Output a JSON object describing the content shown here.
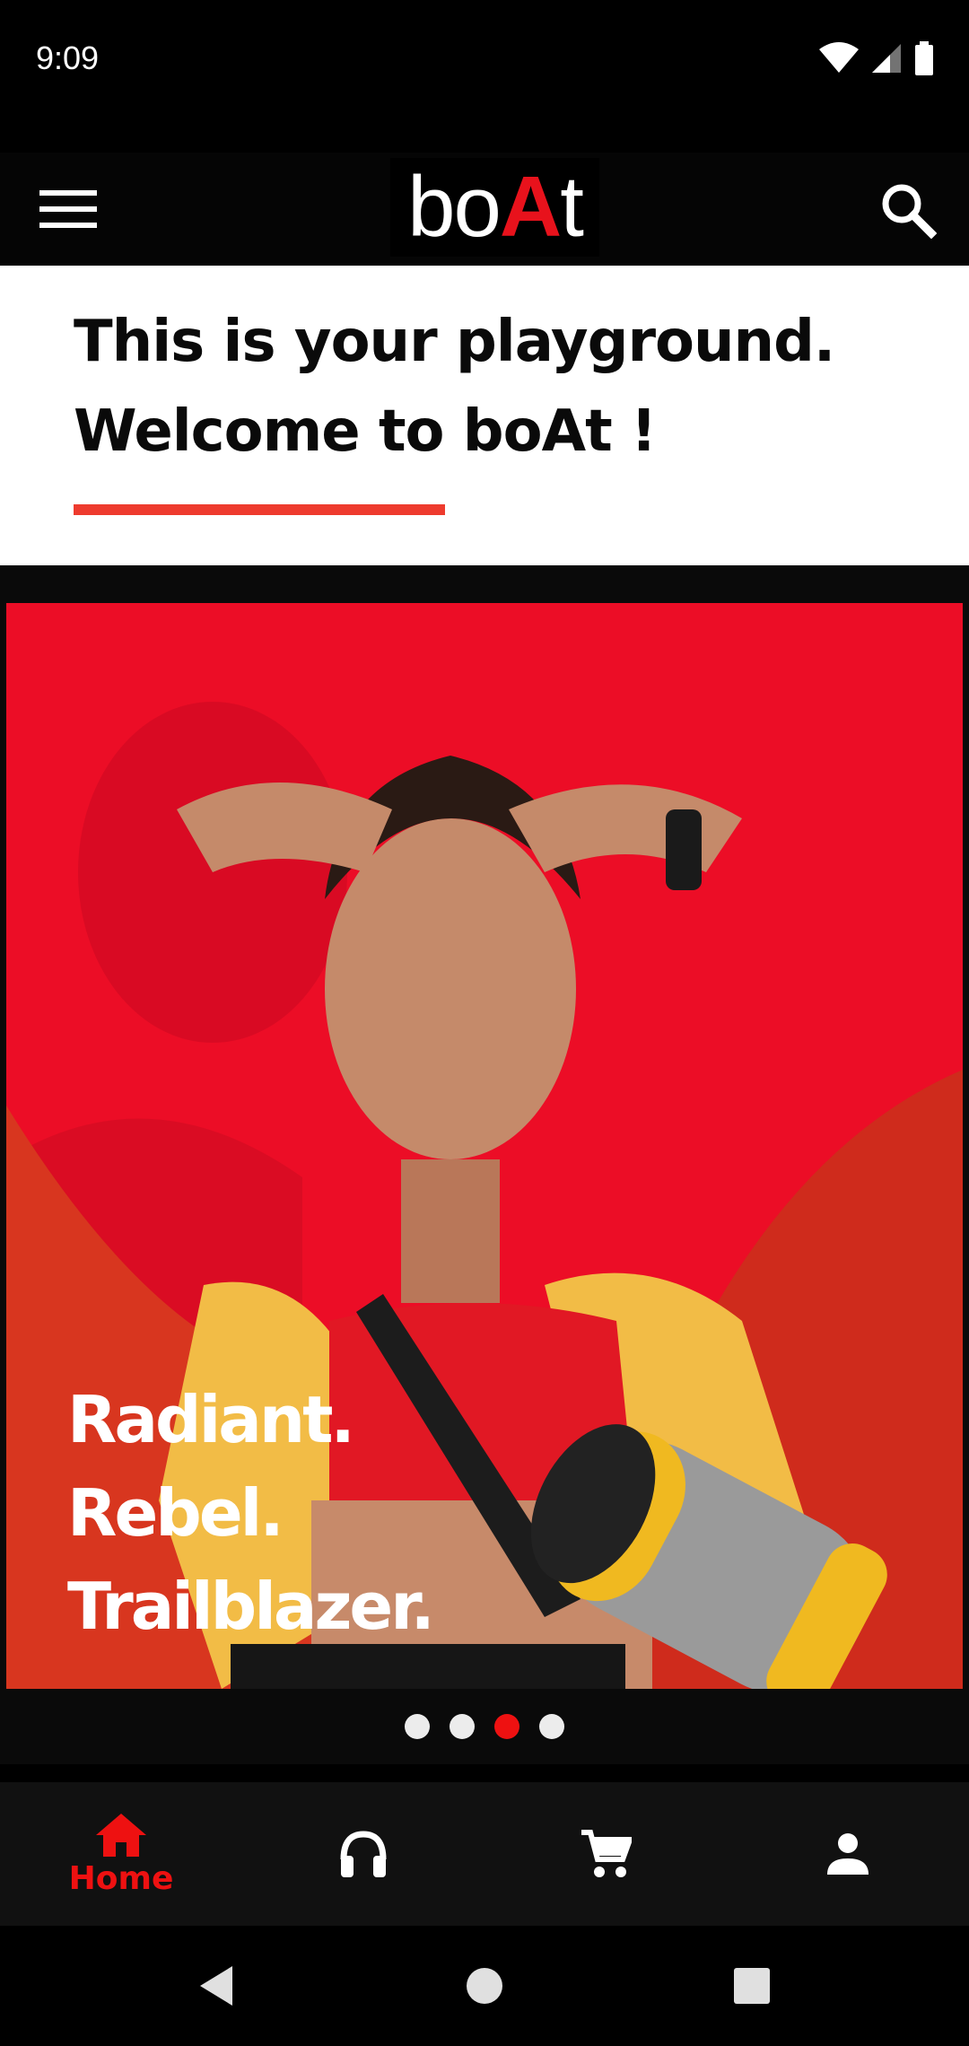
{
  "status_bar": {
    "time": "9:09"
  },
  "app_bar": {
    "logo_text_b": "bo",
    "logo_text_a": "A",
    "logo_text_t": "t"
  },
  "welcome": {
    "line1": "This is your playground.",
    "line2": "Welcome to boAt !"
  },
  "banner": {
    "line1": "Radiant.",
    "line2": "Rebel.",
    "line3": "Trailblazer.",
    "slide_index": 3,
    "slide_count": 4
  },
  "bottom_nav": {
    "items": [
      {
        "icon": "home-icon",
        "label": "Home",
        "active": true
      },
      {
        "icon": "headphones-icon",
        "label": "",
        "active": false
      },
      {
        "icon": "cart-icon",
        "label": "",
        "active": false
      },
      {
        "icon": "account-icon",
        "label": "",
        "active": false
      }
    ]
  },
  "colors": {
    "accent": "#ee1111",
    "banner_bg": "#ec0d26",
    "underline": "#ee3b2e"
  }
}
